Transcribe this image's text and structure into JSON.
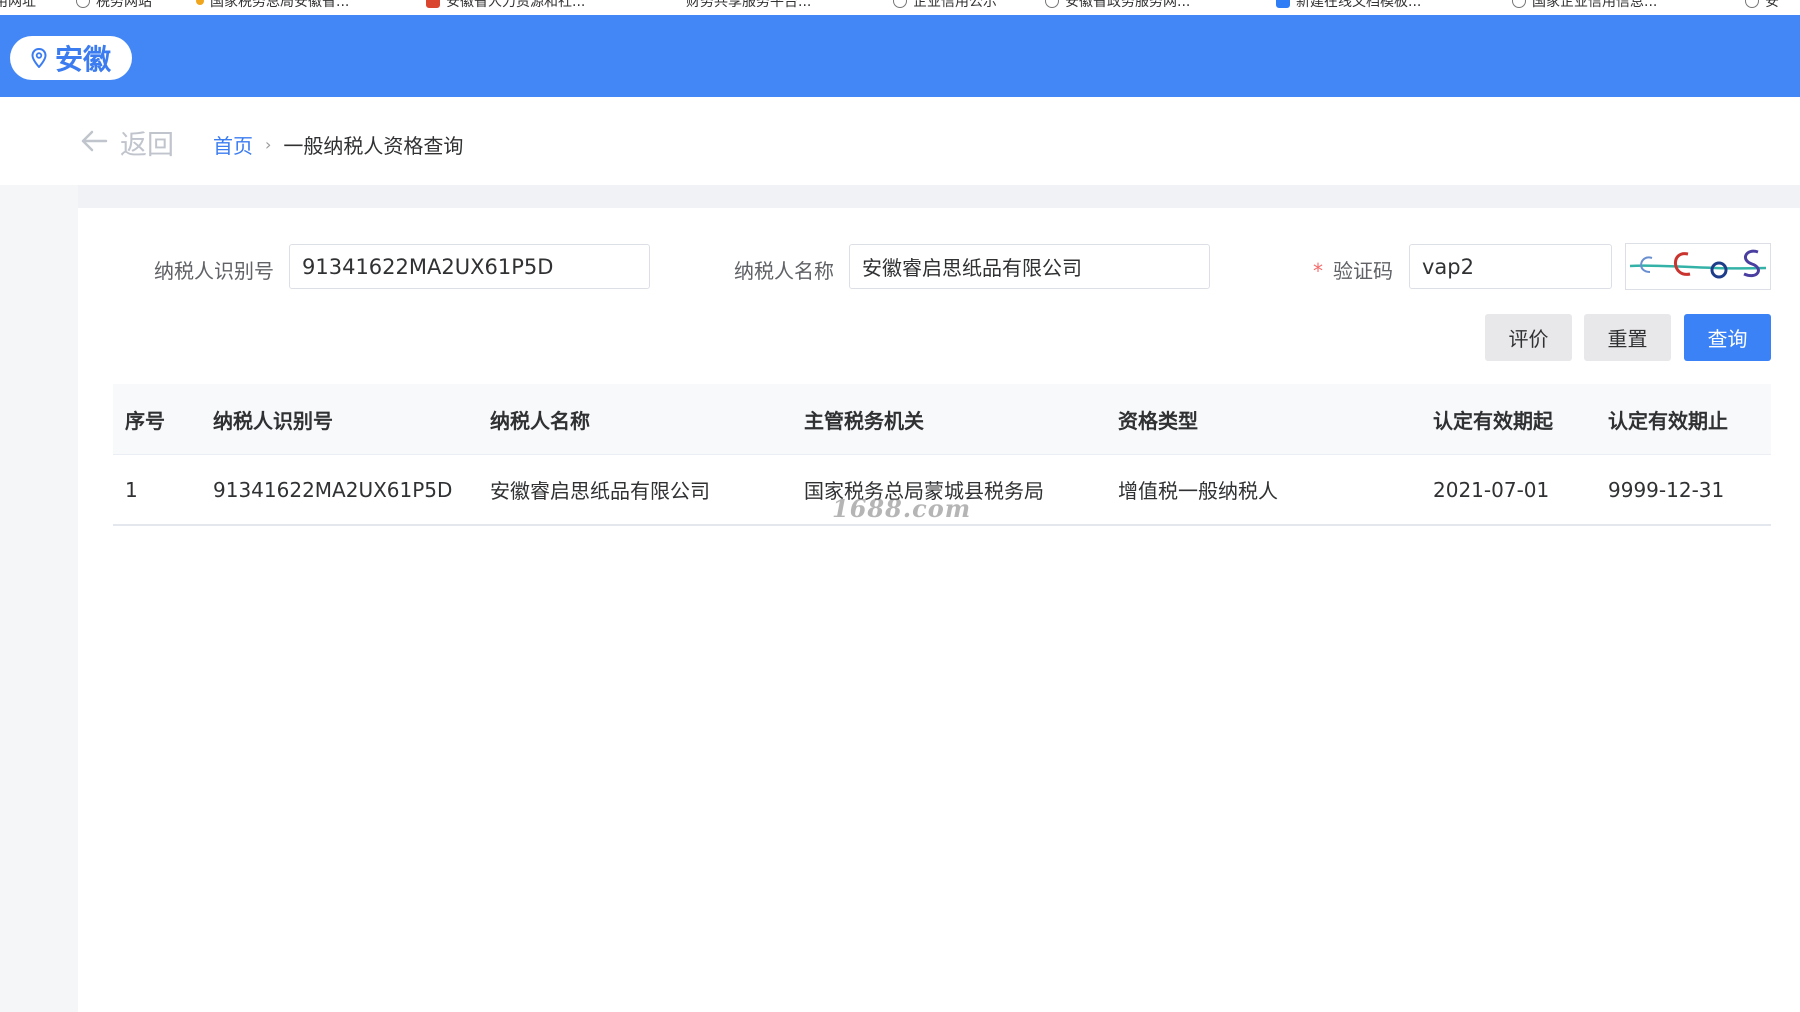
{
  "bookmarks": [
    {
      "label": "常用网址",
      "icon": "globe-icon"
    },
    {
      "label": "税务网站",
      "icon": "globe-icon"
    },
    {
      "label": "国家税务总局安徽省...",
      "icon": "dot-icon"
    },
    {
      "label": "安徽省人力资源和社...",
      "icon": "red-square-icon"
    },
    {
      "label": "财务共享服务平台...",
      "icon": "none"
    },
    {
      "label": "企业信用公示",
      "icon": "globe-icon"
    },
    {
      "label": "安徽省政务服务网...",
      "icon": "globe-icon"
    },
    {
      "label": "新建在线文档模板...",
      "icon": "blue-square-icon"
    },
    {
      "label": "国家企业信用信息...",
      "icon": "globe-icon"
    },
    {
      "label": "安",
      "icon": "globe-icon"
    }
  ],
  "header": {
    "region": "安徽"
  },
  "breadcrumb": {
    "back_label": "返回",
    "home": "首页",
    "separator": "›",
    "current": "一般纳税人资格查询"
  },
  "form": {
    "taxpayer_id_label": "纳税人识别号",
    "taxpayer_id_value": "91341622MA2UX61P5D",
    "taxpayer_name_label": "纳税人名称",
    "taxpayer_name_value": "安徽睿启思纸品有限公司",
    "captcha_required_mark": "*",
    "captcha_label": "验证码",
    "captcha_value": "vap2"
  },
  "buttons": {
    "evaluate": "评价",
    "reset": "重置",
    "query": "查询"
  },
  "table": {
    "headers": [
      "序号",
      "纳税人识别号",
      "纳税人名称",
      "主管税务机关",
      "资格类型",
      "认定有效期起",
      "认定有效期止"
    ],
    "rows": [
      [
        "1",
        "91341622MA2UX61P5D",
        "安徽睿启思纸品有限公司",
        "国家税务总局蒙城县税务局",
        "增值税一般纳税人",
        "2021-07-01",
        "9999-12-31"
      ]
    ]
  },
  "watermark": "1688.com",
  "colors": {
    "header_bg": "#4287f5",
    "primary": "#3b82f6",
    "link": "#3b7cf1",
    "required": "#f56c6c"
  }
}
